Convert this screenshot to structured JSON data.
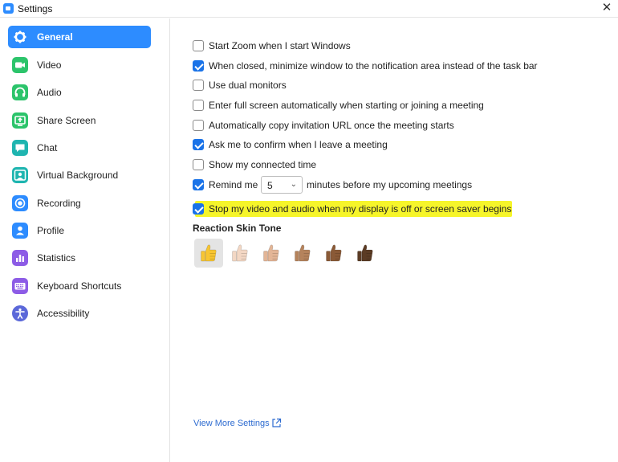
{
  "window": {
    "title": "Settings"
  },
  "sidebar": {
    "items": [
      {
        "label": "General",
        "icon": "gear-icon",
        "active": true
      },
      {
        "label": "Video",
        "icon": "video-camera-icon"
      },
      {
        "label": "Audio",
        "icon": "headphones-icon"
      },
      {
        "label": "Share Screen",
        "icon": "share-screen-icon"
      },
      {
        "label": "Chat",
        "icon": "chat-bubble-icon"
      },
      {
        "label": "Virtual Background",
        "icon": "person-background-icon"
      },
      {
        "label": "Recording",
        "icon": "record-icon"
      },
      {
        "label": "Profile",
        "icon": "person-icon"
      },
      {
        "label": "Statistics",
        "icon": "bar-chart-icon"
      },
      {
        "label": "Keyboard Shortcuts",
        "icon": "keyboard-icon"
      },
      {
        "label": "Accessibility",
        "icon": "accessibility-icon"
      }
    ]
  },
  "general": {
    "options": [
      {
        "label": "Start Zoom when I start Windows",
        "checked": false
      },
      {
        "label": "When closed, minimize window to the notification area instead of the task bar",
        "checked": true
      },
      {
        "label": "Use dual monitors",
        "checked": false
      },
      {
        "label": "Enter full screen automatically when starting or joining a meeting",
        "checked": false
      },
      {
        "label": "Automatically copy invitation URL once the meeting starts",
        "checked": false
      },
      {
        "label": "Ask me to confirm when I leave a meeting",
        "checked": true
      },
      {
        "label": "Show my connected time",
        "checked": false
      }
    ],
    "remind": {
      "label": "Remind me",
      "checked": true,
      "value": "5",
      "suffix": "minutes before my upcoming meetings"
    },
    "stop_video": {
      "label": "Stop my video and audio when my display is off or screen saver begins",
      "checked": true,
      "highlight_color": "#f6f52a"
    },
    "reaction_skin_tone": {
      "title": "Reaction Skin Tone",
      "tones": [
        "#f7c531",
        "#f3d7c4",
        "#e3b596",
        "#b5835c",
        "#8a5a37",
        "#5b3b24"
      ],
      "selected_index": 0
    },
    "view_more": "View More Settings"
  },
  "colors": {
    "accent": "#2d8cff",
    "checkbox": "#1a73e8",
    "link": "#2d6bd0"
  }
}
